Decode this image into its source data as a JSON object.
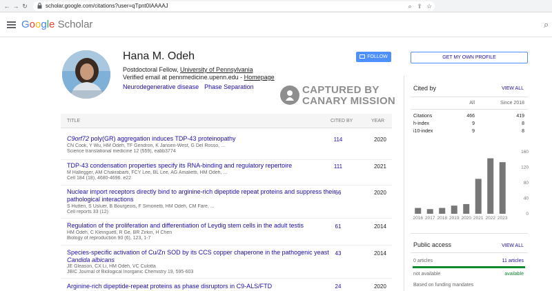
{
  "browser": {
    "url": "scholar.google.com/citations?user=qTpnt0IAAAAJ"
  },
  "header": {
    "logo_google": "Google",
    "logo_scholar": "Scholar"
  },
  "profile": {
    "name": "Hana M. Odeh",
    "position_prefix": "Postdoctoral Fellow, ",
    "affiliation": "University of Pennsylvania",
    "email_text": "Verified email at pennmedicine.upenn.edu - ",
    "homepage": "Homepage",
    "interests": [
      "Neurodegenerative disease",
      "Phase Separation"
    ],
    "follow_label": "FOLLOW"
  },
  "watermark": {
    "line1": "CAPTURED BY",
    "line2": "CANARY MISSION"
  },
  "table": {
    "col_title": "TITLE",
    "col_cited": "CITED BY",
    "col_year": "YEAR"
  },
  "articles": [
    {
      "title_italic": "C9orf72",
      "title": " poly(GR) aggregation induces TDP-43 proteinopathy",
      "authors": "CN Cook, Y Wu, HM Odeh, TF Gendron, K Jansen-West, G Del Rosso, ...",
      "venue": "Science translational medicine 12 (559), eabb3774",
      "cited": "114",
      "year": "2020"
    },
    {
      "title_italic": "",
      "title": "TDP-43 condensation properties specify its RNA-binding and regulatory repertoire",
      "authors": "M Hallegger, AM Chakrabarti, FCY Lee, BL Lee, AG Amalietti, HM Odeh, ...",
      "venue": "Cell 184 (18), 4680-4696. e22",
      "cited": "111",
      "year": "2021"
    },
    {
      "title_italic": "",
      "title": "Nuclear import receptors directly bind to arginine-rich dipeptide repeat proteins and suppress their pathological interactions",
      "authors": "S Hutten, S Usluer, B Bourgeois, F Simonetti, HM Odeh, CM Fare, ...",
      "venue": "Cell reports 33 (12)",
      "cited": "66",
      "year": "2020"
    },
    {
      "title_italic": "",
      "title": "Regulation of the proliferation and differentiation of Leydig stem cells in the adult testis",
      "authors": "HM Odeh, C Kleinguetl, R Ge, BR Zirkin, H Chen",
      "venue": "Biology of reproduction 90 (6), 123, 1-7",
      "cited": "61",
      "year": "2014"
    },
    {
      "title_italic": "",
      "title": "Species-specific activation of Cu/Zn SOD by its CCS copper chaperone in the pathogenic yeast ",
      "title_italic_end": "Candida albicans",
      "authors": "JE Gleason, CX Li, HM Odeh, VC Culotta",
      "venue": "JBIC Journal of Biological Inorganic Chemistry 19, 595-603",
      "cited": "43",
      "year": "2014"
    },
    {
      "title_italic": "",
      "title": "Arginine-rich dipeptide-repeat proteins as phase disruptors in C9-ALS/FTD",
      "authors": "",
      "venue": "",
      "cited": "24",
      "year": "2020"
    }
  ],
  "sidebar": {
    "get_profile": "GET MY OWN PROFILE",
    "cited_by": {
      "title": "Cited by",
      "view_all": "VIEW ALL",
      "col_all": "All",
      "col_since": "Since 2018",
      "rows": [
        {
          "label": "Citations",
          "all": "466",
          "since": "419"
        },
        {
          "label": "h-index",
          "all": "9",
          "since": "8"
        },
        {
          "label": "i10-index",
          "all": "9",
          "since": "8"
        }
      ]
    },
    "public_access": {
      "title": "Public access",
      "view_all": "VIEW ALL",
      "not_available_count": "0 articles",
      "available_count": "11 articles",
      "not_available": "not available",
      "available": "available",
      "mandates": "Based on funding mandates"
    }
  },
  "chart_data": {
    "type": "bar",
    "categories": [
      "2016",
      "2017",
      "2018",
      "2019",
      "2020",
      "2021",
      "2022",
      "2023"
    ],
    "values": [
      15,
      12,
      15,
      21,
      25,
      90,
      143,
      133
    ],
    "ylim": [
      0,
      160
    ],
    "yticks": [
      "0",
      "40",
      "80",
      "120",
      "160"
    ],
    "color": "#777777"
  }
}
